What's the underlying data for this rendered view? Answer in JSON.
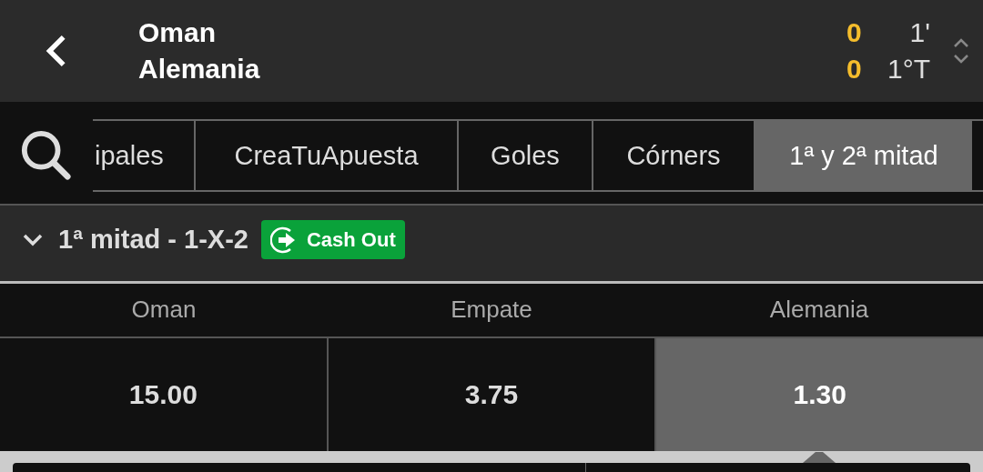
{
  "header": {
    "teams": [
      {
        "name": "Oman",
        "score": "0",
        "time": "1'"
      },
      {
        "name": "Alemania",
        "score": "0",
        "time": "1°T"
      }
    ]
  },
  "tabs": [
    {
      "label": "ipales",
      "selected": false
    },
    {
      "label": "CreaTuApuesta",
      "selected": false
    },
    {
      "label": "Goles",
      "selected": false
    },
    {
      "label": "Córners",
      "selected": false
    },
    {
      "label": "1ª y 2ª mitad",
      "selected": true
    }
  ],
  "market": {
    "title": "1ª mitad - 1-X-2",
    "expanded": true,
    "badge": "Cash Out"
  },
  "outcomes": [
    {
      "label": "Oman",
      "odds": "15.00",
      "selected": false
    },
    {
      "label": "Empate",
      "odds": "3.75",
      "selected": false
    },
    {
      "label": "Alemania",
      "odds": "1.30",
      "selected": true
    }
  ]
}
